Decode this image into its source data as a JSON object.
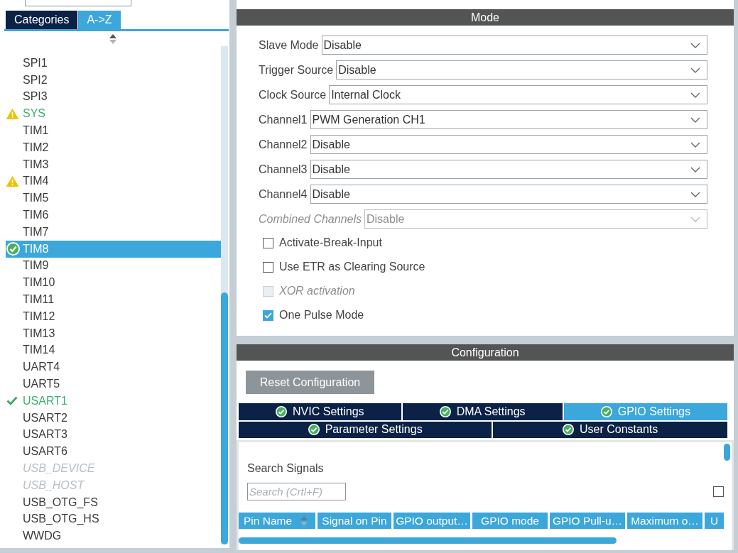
{
  "sidebar": {
    "tabs": [
      {
        "label": "Categories",
        "selected": false
      },
      {
        "label": "A->Z",
        "selected": true
      }
    ],
    "items": [
      {
        "label": "SPI1",
        "kind": "plain",
        "configured": false,
        "disabled": false,
        "selected": false
      },
      {
        "label": "SPI2",
        "kind": "plain",
        "configured": false,
        "disabled": false,
        "selected": false
      },
      {
        "label": "SPI3",
        "kind": "plain",
        "configured": false,
        "disabled": false,
        "selected": false
      },
      {
        "label": "SYS",
        "kind": "warning",
        "configured": true,
        "disabled": false,
        "selected": false
      },
      {
        "label": "TIM1",
        "kind": "plain",
        "configured": false,
        "disabled": false,
        "selected": false
      },
      {
        "label": "TIM2",
        "kind": "plain",
        "configured": false,
        "disabled": false,
        "selected": false
      },
      {
        "label": "TIM3",
        "kind": "plain",
        "configured": false,
        "disabled": false,
        "selected": false
      },
      {
        "label": "TIM4",
        "kind": "warning",
        "configured": false,
        "disabled": false,
        "selected": false
      },
      {
        "label": "TIM5",
        "kind": "plain",
        "configured": false,
        "disabled": false,
        "selected": false
      },
      {
        "label": "TIM6",
        "kind": "plain",
        "configured": false,
        "disabled": false,
        "selected": false
      },
      {
        "label": "TIM7",
        "kind": "plain",
        "configured": false,
        "disabled": false,
        "selected": false
      },
      {
        "label": "TIM8",
        "kind": "ok",
        "configured": true,
        "disabled": false,
        "selected": true
      },
      {
        "label": "TIM9",
        "kind": "plain",
        "configured": false,
        "disabled": false,
        "selected": false
      },
      {
        "label": "TIM10",
        "kind": "plain",
        "configured": false,
        "disabled": false,
        "selected": false
      },
      {
        "label": "TIM11",
        "kind": "plain",
        "configured": false,
        "disabled": false,
        "selected": false
      },
      {
        "label": "TIM12",
        "kind": "plain",
        "configured": false,
        "disabled": false,
        "selected": false
      },
      {
        "label": "TIM13",
        "kind": "plain",
        "configured": false,
        "disabled": false,
        "selected": false
      },
      {
        "label": "TIM14",
        "kind": "plain",
        "configured": false,
        "disabled": false,
        "selected": false
      },
      {
        "label": "UART4",
        "kind": "plain",
        "configured": false,
        "disabled": false,
        "selected": false
      },
      {
        "label": "UART5",
        "kind": "plain",
        "configured": false,
        "disabled": false,
        "selected": false
      },
      {
        "label": "USART1",
        "kind": "ok",
        "configured": true,
        "disabled": false,
        "selected": false
      },
      {
        "label": "USART2",
        "kind": "plain",
        "configured": false,
        "disabled": false,
        "selected": false
      },
      {
        "label": "USART3",
        "kind": "plain",
        "configured": false,
        "disabled": false,
        "selected": false
      },
      {
        "label": "USART6",
        "kind": "plain",
        "configured": false,
        "disabled": false,
        "selected": false
      },
      {
        "label": "USB_DEVICE",
        "kind": "plain",
        "configured": false,
        "disabled": true,
        "selected": false
      },
      {
        "label": "USB_HOST",
        "kind": "plain",
        "configured": false,
        "disabled": true,
        "selected": false
      },
      {
        "label": "USB_OTG_FS",
        "kind": "plain",
        "configured": false,
        "disabled": false,
        "selected": false
      },
      {
        "label": "USB_OTG_HS",
        "kind": "plain",
        "configured": false,
        "disabled": false,
        "selected": false
      },
      {
        "label": "WWDG",
        "kind": "plain",
        "configured": false,
        "disabled": false,
        "selected": false
      }
    ]
  },
  "mode": {
    "title": "Mode",
    "fields": [
      {
        "label": "Slave Mode",
        "value": "Disable",
        "disabled": false
      },
      {
        "label": "Trigger Source",
        "value": "Disable",
        "disabled": false
      },
      {
        "label": "Clock Source",
        "value": "Internal Clock",
        "disabled": false
      },
      {
        "label": "Channel1",
        "value": "PWM Generation CH1",
        "disabled": false
      },
      {
        "label": "Channel2",
        "value": "Disable",
        "disabled": false
      },
      {
        "label": "Channel3",
        "value": "Disable",
        "disabled": false
      },
      {
        "label": "Channel4",
        "value": "Disable",
        "disabled": false
      },
      {
        "label": "Combined Channels",
        "value": "Disable",
        "disabled": true
      }
    ],
    "options": [
      {
        "label": "Activate-Break-Input",
        "checked": false,
        "disabled": false
      },
      {
        "label": "Use ETR as Clearing Source",
        "checked": false,
        "disabled": false
      },
      {
        "label": "XOR activation",
        "checked": false,
        "disabled": true
      },
      {
        "label": "One Pulse Mode",
        "checked": true,
        "disabled": false
      }
    ]
  },
  "configuration": {
    "title": "Configuration",
    "reset_button": "Reset Configuration",
    "tab_rows": [
      {
        "tabs": [
          {
            "label": "NVIC Settings",
            "selected": false
          },
          {
            "label": "DMA Settings",
            "selected": false
          },
          {
            "label": "GPIO Settings",
            "selected": true
          }
        ]
      },
      {
        "tabs": [
          {
            "label": "Parameter Settings",
            "selected": false
          },
          {
            "label": "User Constants",
            "selected": false
          }
        ]
      }
    ],
    "signals": {
      "label": "Search Signals",
      "placeholder": "Search (Crtl+F)",
      "filter_checked": false
    },
    "table": {
      "columns": [
        {
          "label": "Pin Name",
          "sorted": true
        },
        {
          "label": "Signal on Pin",
          "sorted": false
        },
        {
          "label": "GPIO output…",
          "sorted": false
        },
        {
          "label": "GPIO mode",
          "sorted": false
        },
        {
          "label": "GPIO Pull-u…",
          "sorted": false
        },
        {
          "label": "Maximum o…",
          "sorted": false
        },
        {
          "label": "U",
          "sorted": false
        }
      ]
    }
  }
}
